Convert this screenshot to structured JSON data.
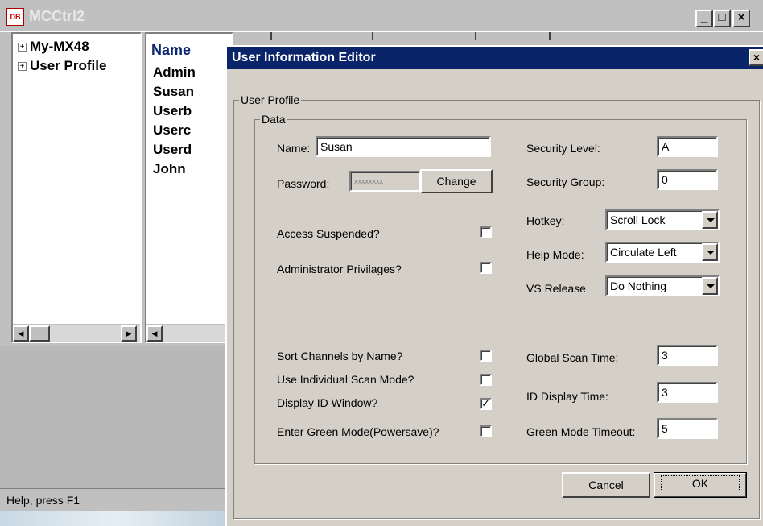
{
  "main_window": {
    "title": "MCCtrl2",
    "app_icon_text": "DB",
    "minimize": "_",
    "maximize": "□",
    "close": "×"
  },
  "tree": {
    "items": [
      {
        "expander": "+",
        "label": "My-MX48"
      },
      {
        "expander": "+",
        "label": "User Profile"
      }
    ]
  },
  "list": {
    "column_header": "Name",
    "items": [
      "Admin",
      "Susan",
      "Userb",
      "Userc",
      "Userd",
      "John"
    ]
  },
  "status_bar": {
    "text": "Help, press F1"
  },
  "dialog": {
    "title": "User Information Editor",
    "close": "×",
    "group_profile": "User Profile",
    "group_data": "Data",
    "name_label": "Name:",
    "name_value": "Susan",
    "password_label": "Password:",
    "password_value": "xxxxxxxx",
    "change_button": "Change",
    "access_suspended_label": "Access Suspended?",
    "access_suspended_checked": false,
    "admin_label": "Administrator Privilages?",
    "admin_checked": false,
    "security_level_label": "Security Level:",
    "security_level_value": "A",
    "security_group_label": "Security Group:",
    "security_group_value": "0",
    "hotkey_label": "Hotkey:",
    "hotkey_value": "Scroll Lock",
    "help_mode_label": "Help Mode:",
    "help_mode_value": "Circulate Left",
    "vs_release_label": "VS Release",
    "vs_release_value": "Do Nothing",
    "sort_channels_label": "Sort Channels by Name?",
    "sort_channels_checked": false,
    "individual_scan_label": "Use Individual Scan Mode?",
    "individual_scan_checked": false,
    "display_id_label": "Display ID Window?",
    "display_id_checked": true,
    "green_mode_label": "Enter Green Mode(Powersave)?",
    "green_mode_checked": false,
    "global_scan_label": "Global Scan Time:",
    "global_scan_value": "3",
    "id_display_label": "ID Display Time:",
    "id_display_value": "3",
    "green_timeout_label": "Green Mode Timeout:",
    "green_timeout_value": "5",
    "cancel_button": "Cancel",
    "ok_button": "OK"
  },
  "colors": {
    "dialog_title_bg": "#0a246a",
    "list_header_text": "#0a2670",
    "face": "#d4d0c8"
  }
}
